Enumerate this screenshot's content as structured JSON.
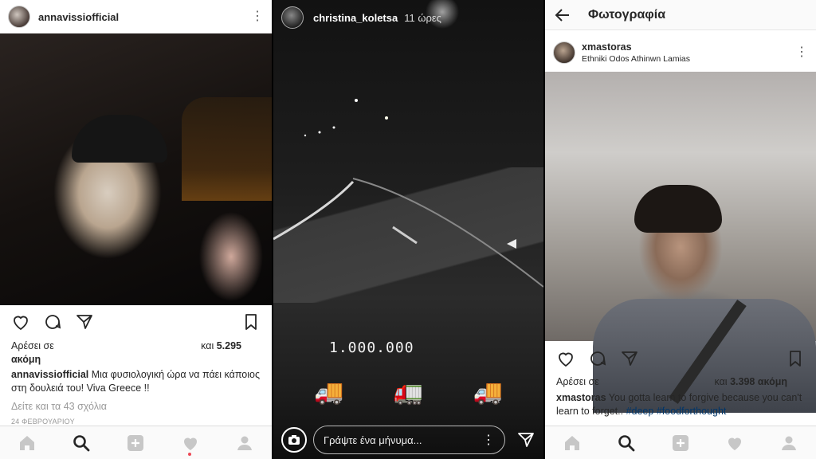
{
  "panel1": {
    "username": "annavissiofficial",
    "likes_prefix": "Αρέσει σε",
    "likes_suffix_and": "και",
    "likes_count": "5.295",
    "likes_more": "ακόμη",
    "caption_user": "annavissiofficial",
    "caption_text": " Μια φυσιολογική ώρα να πάει κάποιος στη δουλειά του! Viva Greece !!",
    "view_comments": "Δείτε και τα 43 σχόλια",
    "date": "24 ΦΕΒΡΟΥΑΡΙΟΥ"
  },
  "panel2": {
    "username": "christina_koletsa",
    "time": "11 ώρες",
    "overlay_text": "1.000.000",
    "trucks": [
      "🚚",
      "🚛",
      "🚚"
    ],
    "message_placeholder": "Γράψτε ένα μήνυμα..."
  },
  "panel3": {
    "screen_title": "Φωτογραφία",
    "username": "xmastoras",
    "location": "Ethniki Odos Athinwn Lamias",
    "likes_prefix": "Αρέσει σε",
    "likes_suffix_and": "και",
    "likes_count": "3.398",
    "likes_more": "ακόμη",
    "caption_user": "xmastoras",
    "caption_text": " You gotta learn to forgive because you can't learn to forget.. ",
    "hashtags": [
      "#deep",
      "#foodforthought"
    ]
  },
  "icons": [
    "heart-icon",
    "comment-icon",
    "send-icon",
    "bookmark-icon",
    "home-icon",
    "search-icon",
    "add-icon",
    "activity-heart-icon",
    "profile-icon",
    "camera-icon",
    "back-arrow-icon",
    "more-icon"
  ],
  "colors": {
    "notification": "#ed4956",
    "hashtag": "#003569",
    "text": "#262626"
  }
}
